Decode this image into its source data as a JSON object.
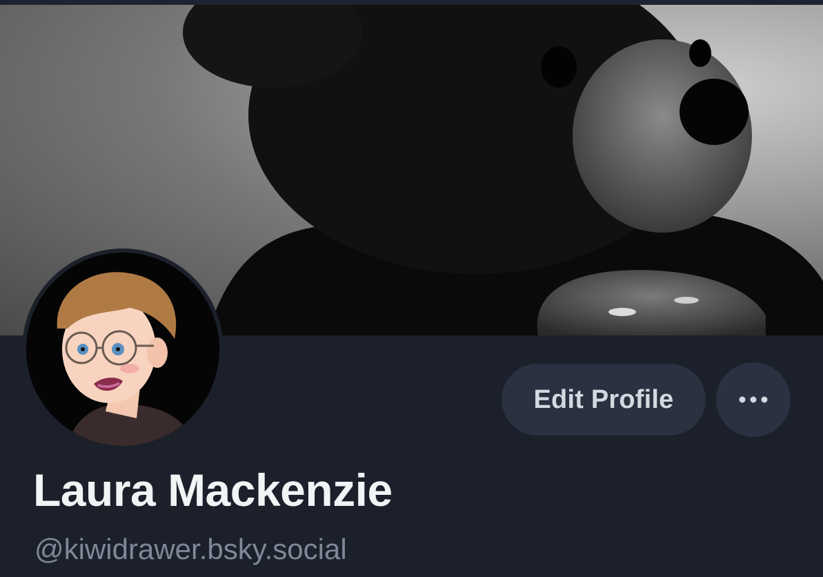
{
  "profile": {
    "display_name": "Laura Mackenzie",
    "handle": "@kiwidrawer.bsky.social",
    "banner": "banner-image",
    "avatar": "avatar-image"
  },
  "actions": {
    "edit_label": "Edit Profile",
    "more_icon": "ellipsis-icon"
  },
  "colors": {
    "background": "#1b202a",
    "button_bg": "#2a3140",
    "name_text": "#f1f3f5",
    "handle_text": "#7f8898"
  }
}
